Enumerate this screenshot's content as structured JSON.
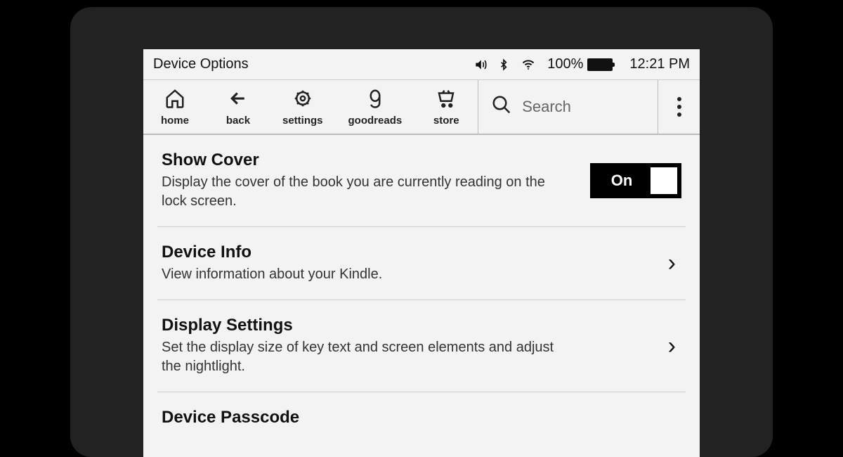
{
  "statusBar": {
    "title": "Device Options",
    "batteryPercent": "100%",
    "batteryFillPercent": 100,
    "time": "12:21 PM"
  },
  "toolbar": {
    "items": [
      {
        "label": "home"
      },
      {
        "label": "back"
      },
      {
        "label": "settings"
      },
      {
        "label": "goodreads"
      },
      {
        "label": "store"
      }
    ],
    "searchPlaceholder": "Search"
  },
  "settings": [
    {
      "title": "Show Cover",
      "description": "Display the cover of the book you are currently reading on the lock screen.",
      "type": "toggle",
      "value": "On"
    },
    {
      "title": "Device Info",
      "description": "View information about your Kindle.",
      "type": "nav"
    },
    {
      "title": "Display Settings",
      "description": "Set the display size of key text and screen elements and adjust the nightlight.",
      "type": "nav"
    },
    {
      "title": "Device Passcode",
      "description": "",
      "type": "nav"
    }
  ]
}
